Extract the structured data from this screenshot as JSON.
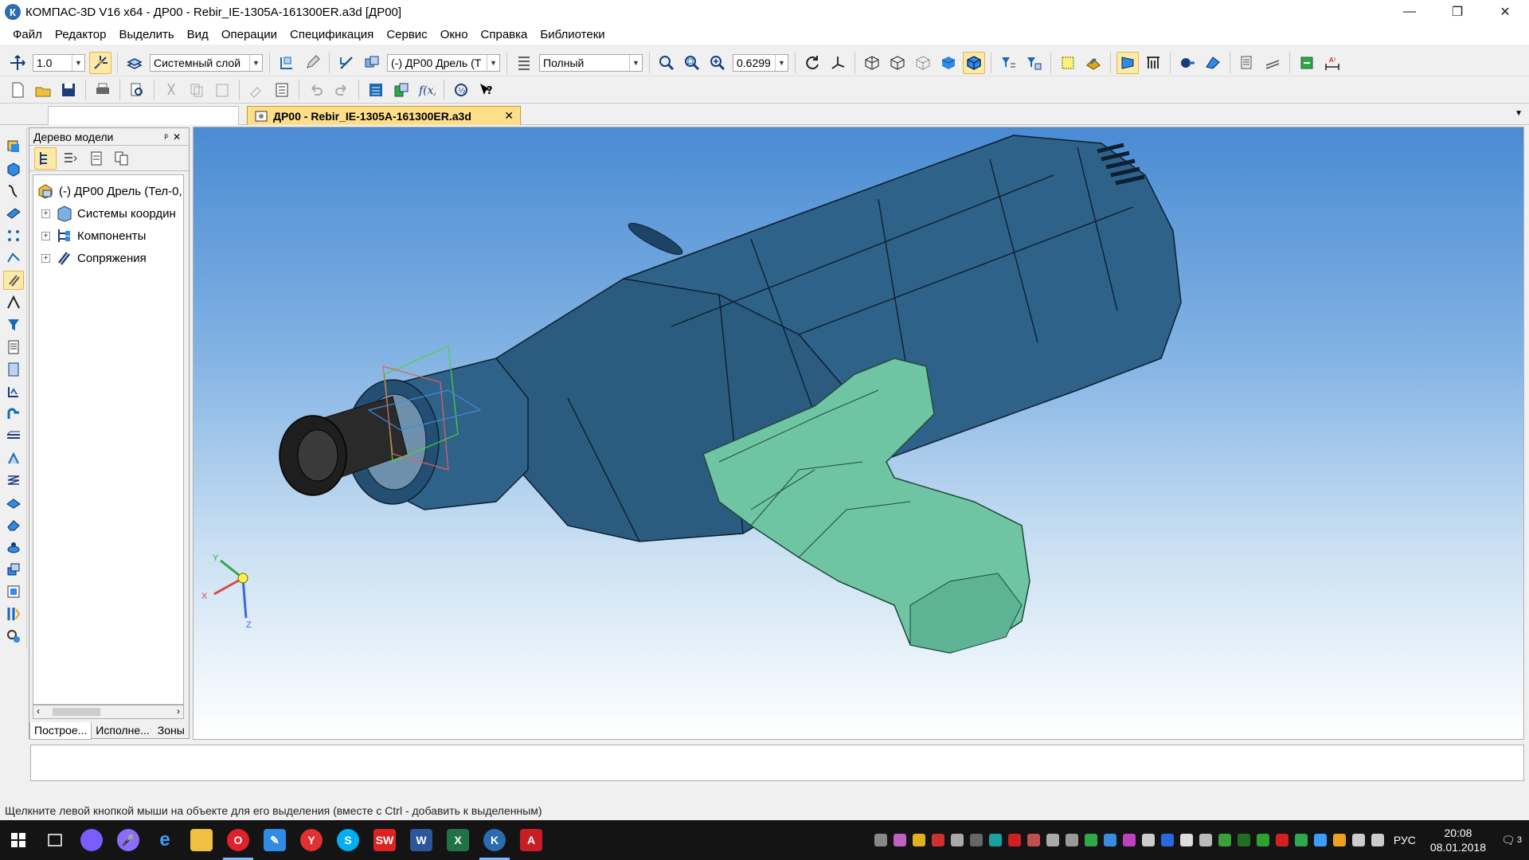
{
  "window": {
    "title": "КОМПАС-3D V16  x64 - ДР00 - Rebir_IE-1305A-161300ER.a3d [ДР00]",
    "app_icon": "К",
    "minimize": "—",
    "restore": "❐",
    "close": "✕"
  },
  "menu": [
    "Файл",
    "Редактор",
    "Выделить",
    "Вид",
    "Операции",
    "Спецификация",
    "Сервис",
    "Окно",
    "Справка",
    "Библиотеки"
  ],
  "toolbar": {
    "step_value": "1.0",
    "layer_value": "Системный слой",
    "part_value": "(-) ДР00 Дрель (Т",
    "mode_value": "Полный",
    "zoom_value": "0.6299"
  },
  "document_tab": {
    "label": "ДР00 - Rebir_IE-1305A-161300ER.a3d",
    "close": "✕"
  },
  "tree_panel": {
    "title": "Дерево модели",
    "pin": "ᵖ",
    "close": "✕",
    "root": "(-) ДР00 Дрель (Тел-0,",
    "items": [
      {
        "label": "Системы координ",
        "icon": "coordinate-system-icon"
      },
      {
        "label": "Компоненты",
        "icon": "components-icon"
      },
      {
        "label": "Сопряжения",
        "icon": "mates-icon"
      }
    ],
    "tabs": [
      "Построе...",
      "Исполне...",
      "Зоны"
    ]
  },
  "axis_labels": {
    "x": "X",
    "y": "Y",
    "z": "Z"
  },
  "status_text": "Щелкните левой кнопкой мыши на объекте для его выделения (вместе с Ctrl - добавить к выделенным)",
  "taskbar": {
    "lang": "РУС",
    "time": "20:08",
    "date": "08.01.2018",
    "notifications": "3"
  },
  "colors": {
    "body_blue": "#2f6288",
    "handle_green": "#6fc4a4",
    "chuck_black": "#2a2a2a",
    "active_tab": "#fddf8b"
  }
}
